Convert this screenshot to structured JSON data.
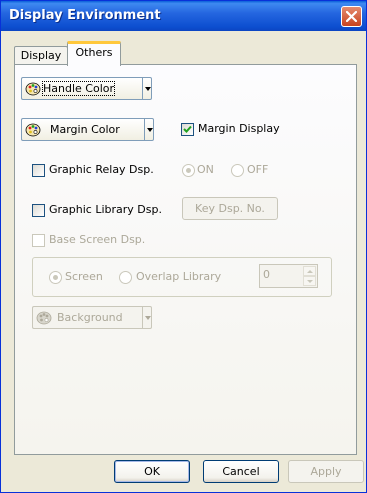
{
  "window": {
    "title": "Display Environment"
  },
  "tabs": [
    {
      "label": "Display",
      "active": false
    },
    {
      "label": "Others",
      "active": true
    }
  ],
  "handle_color": {
    "label": "Handle Color"
  },
  "margin_color": {
    "label": "Margin Color"
  },
  "margin_display": {
    "label": "Margin Display",
    "checked": true
  },
  "graphic_relay": {
    "label": "Graphic Relay Dsp.",
    "checked": false,
    "on_label": "ON",
    "off_label": "OFF",
    "selected": "ON"
  },
  "graphic_library": {
    "label": "Graphic Library Dsp.",
    "checked": false,
    "key_button": "Key Dsp. No."
  },
  "base_screen": {
    "label": "Base Screen Dsp.",
    "checked": false,
    "screen_label": "Screen",
    "overlap_label": "Overlap Library",
    "selected": "Screen",
    "number": "0"
  },
  "background": {
    "label": "Background"
  },
  "footer": {
    "ok": "OK",
    "cancel": "Cancel",
    "apply": "Apply"
  },
  "colors": {
    "titlebar": "#2566E0",
    "close": "#C8431F",
    "tab_highlight": "#FFC83C",
    "dialog_bg": "#ECE9D8"
  }
}
